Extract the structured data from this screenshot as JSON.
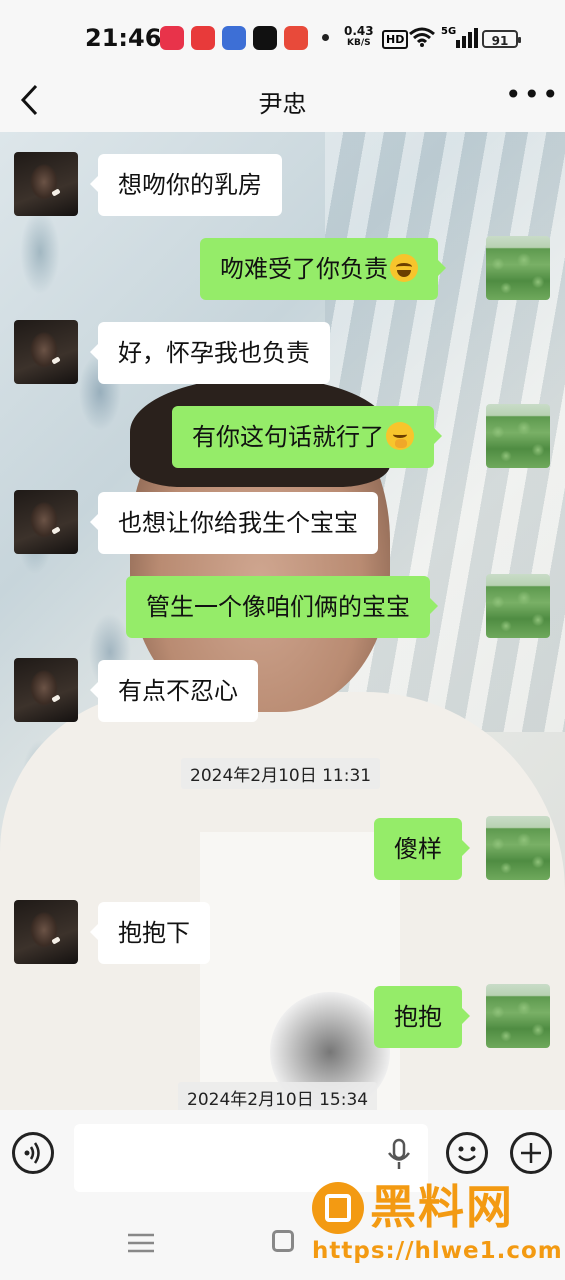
{
  "status_bar": {
    "time": "21:46",
    "net_speed_value": "0.43",
    "net_speed_unit": "KB/S",
    "hd": "HD",
    "signal_label": "5G",
    "battery": "91"
  },
  "header": {
    "title": "尹忠"
  },
  "messages": [
    {
      "side": "left",
      "text": "想吻你的乳房"
    },
    {
      "side": "right",
      "text": "吻难受了你负责",
      "emoji": "laughing-tears-emoji"
    },
    {
      "side": "left",
      "text": "好，怀孕我也负责"
    },
    {
      "side": "right",
      "text": "有你这句话就行了",
      "emoji": "hand-over-mouth-emoji"
    },
    {
      "side": "left",
      "text": "也想让你给我生个宝宝"
    },
    {
      "side": "right",
      "text": "管生一个像咱们俩的宝宝"
    },
    {
      "side": "left",
      "text": "有点不忍心"
    },
    {
      "side": "right",
      "text": "傻样"
    },
    {
      "side": "left",
      "text": "抱抱下"
    },
    {
      "side": "right",
      "text": "抱抱"
    }
  ],
  "timestamps": [
    "2024年2月10日 11:31",
    "2024年2月10日 15:34"
  ],
  "input": {
    "value": ""
  },
  "watermark": {
    "title": "黑料网",
    "url": "https://hlwe1.com"
  },
  "colors": {
    "self_bubble": "#95ec69",
    "other_bubble": "#ffffff",
    "watermark": "#f39a12"
  }
}
